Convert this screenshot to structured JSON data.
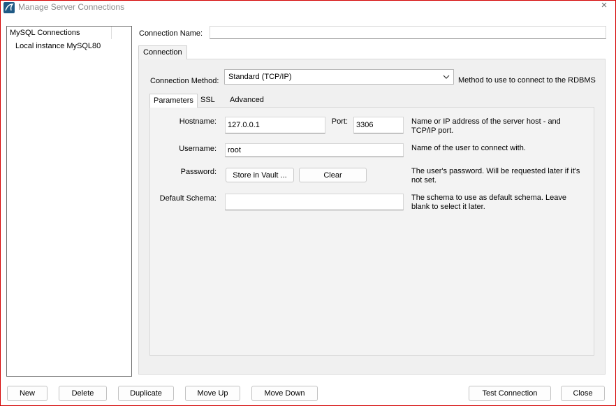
{
  "window": {
    "title": "Manage Server Connections",
    "close_glyph": "×"
  },
  "sidebar": {
    "header": "MySQL Connections",
    "items": [
      {
        "label": "Local instance MySQL80"
      }
    ]
  },
  "connection_name": {
    "label": "Connection Name:",
    "value": ""
  },
  "tabs": {
    "main": [
      {
        "label": "Connection"
      }
    ],
    "sub": [
      {
        "label": "Parameters"
      },
      {
        "label": "SSL"
      },
      {
        "label": "Advanced"
      }
    ]
  },
  "connection_method": {
    "label": "Connection Method:",
    "selected": "Standard (TCP/IP)",
    "description": "Method to use to connect to the RDBMS"
  },
  "parameters": {
    "hostname": {
      "label": "Hostname:",
      "value": "127.0.0.1",
      "description_line1": "Name or IP address of the server host - and",
      "description_line2": "TCP/IP port."
    },
    "port": {
      "label": "Port:",
      "value": "3306"
    },
    "username": {
      "label": "Username:",
      "value": "root",
      "description": "Name of the user to connect with."
    },
    "password": {
      "label": "Password:",
      "store_button": "Store in Vault ...",
      "clear_button": "Clear",
      "description_line1": "The user's password. Will be requested later if it's",
      "description_line2": "not set."
    },
    "default_schema": {
      "label": "Default Schema:",
      "value": "",
      "description_line1": "The schema to use as default schema. Leave",
      "description_line2": "blank to select it later."
    }
  },
  "footer": {
    "new": "New",
    "delete": "Delete",
    "duplicate": "Duplicate",
    "move_up": "Move Up",
    "move_down": "Move Down",
    "test_connection": "Test Connection",
    "close": "Close"
  },
  "colors": {
    "window_border": "#d40000",
    "app_icon": "#1f5a85",
    "panel_bg": "#f0f0f0"
  }
}
